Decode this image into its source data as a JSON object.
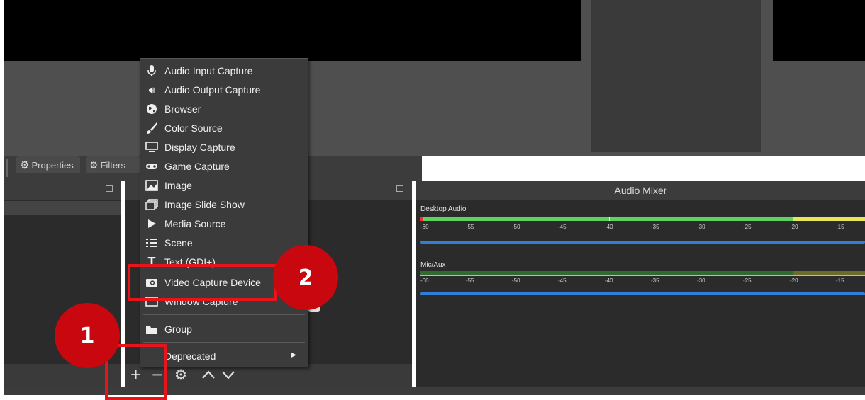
{
  "toolbar": {
    "properties_label": "Properties",
    "filters_label": "Filters"
  },
  "audio_mixer": {
    "title": "Audio Mixer",
    "channels": [
      {
        "name": "Desktop Audio"
      },
      {
        "name": "Mic/Aux"
      }
    ],
    "ticks": [
      "-60",
      "-55",
      "-50",
      "-45",
      "-40",
      "-35",
      "-30",
      "-25",
      "-20",
      "-15"
    ]
  },
  "add_source_menu": {
    "items": [
      {
        "label": "Audio Input Capture",
        "icon": "microphone-icon"
      },
      {
        "label": "Audio Output Capture",
        "icon": "speaker-icon"
      },
      {
        "label": "Browser",
        "icon": "globe-icon"
      },
      {
        "label": "Color Source",
        "icon": "brush-icon"
      },
      {
        "label": "Display Capture",
        "icon": "monitor-icon"
      },
      {
        "label": "Game Capture",
        "icon": "gamepad-icon"
      },
      {
        "label": "Image",
        "icon": "image-icon"
      },
      {
        "label": "Image Slide Show",
        "icon": "slideshow-icon"
      },
      {
        "label": "Media Source",
        "icon": "play-icon"
      },
      {
        "label": "Scene",
        "icon": "list-icon"
      },
      {
        "label": "Text (GDI+)",
        "icon": "text-icon"
      },
      {
        "label": "Video Capture Device",
        "icon": "camera-icon"
      },
      {
        "label": "Window Capture",
        "icon": "window-icon"
      },
      {
        "label": "Group",
        "icon": "folder-icon"
      },
      {
        "label": "Deprecated",
        "icon": "submenu-arrow-icon"
      }
    ]
  },
  "annotations": {
    "step1": "1",
    "step2": "2"
  },
  "colors": {
    "annotation_red": "#e8141a",
    "badge_red": "#c8070f",
    "meter_green": "#5fd35f",
    "meter_yellow": "#e6e65a",
    "volume_blue": "#2f7fd8"
  }
}
